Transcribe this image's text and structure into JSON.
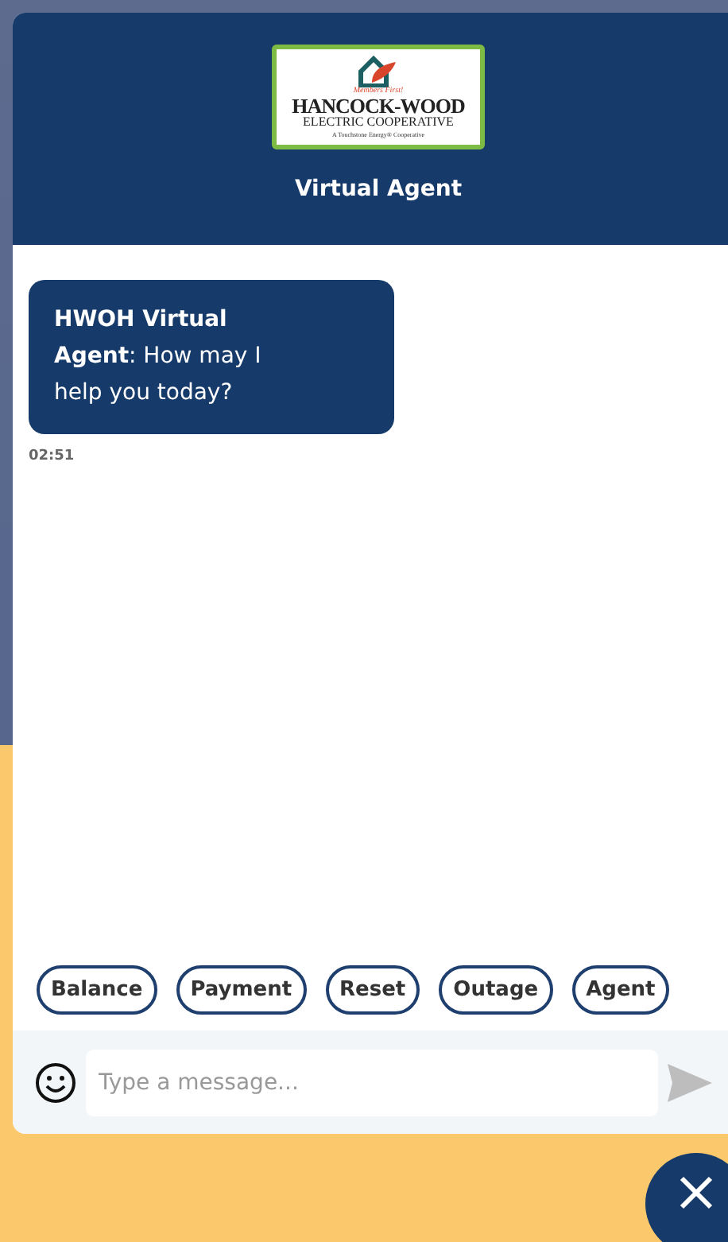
{
  "header": {
    "logo": {
      "tagline": "Members First!",
      "name": "HANCOCK-WOOD",
      "subtitle": "ELECTRIC COOPERATIVE",
      "footer": "A Touchstone Energy® Cooperative"
    },
    "title": "Virtual Agent"
  },
  "messages": [
    {
      "text": "**HWOH Virtual Agent**: How may I help you today?",
      "time": "02:51"
    }
  ],
  "quick_replies": [
    "Balance",
    "Payment",
    "Reset",
    "Outage",
    "Agent"
  ],
  "composer": {
    "placeholder": "Type a message..."
  }
}
